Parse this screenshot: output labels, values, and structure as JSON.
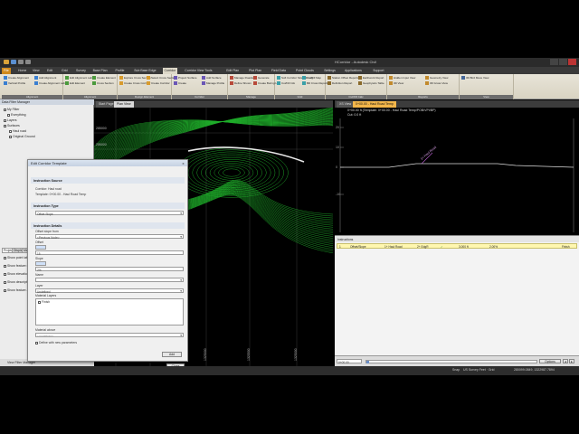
{
  "titlebar": {
    "title": "HCorridor - Autodesk Civil"
  },
  "tabs": [
    {
      "label": "File",
      "file": true
    },
    {
      "label": "Home"
    },
    {
      "label": "View"
    },
    {
      "label": "Edit"
    },
    {
      "label": "Grid"
    },
    {
      "label": "Survey"
    },
    {
      "label": "Base Plan"
    },
    {
      "label": "Profile"
    },
    {
      "label": "Sub Base Edge"
    },
    {
      "label": "Corridor",
      "active": true
    },
    {
      "label": "Corridor View Tools"
    },
    {
      "label": "Edit Plan"
    },
    {
      "label": "Plot Plan"
    },
    {
      "label": "Field Data"
    },
    {
      "label": "Point Clouds"
    },
    {
      "label": "Settings"
    },
    {
      "label": "Applications"
    },
    {
      "label": "Support"
    }
  ],
  "ribbon": {
    "groups": [
      {
        "label": "Alignment"
      },
      {
        "label": "Alignment"
      },
      {
        "label": "Design Element"
      },
      {
        "label": "Corridor"
      },
      {
        "label": "Manage"
      },
      {
        "label": "Grid"
      },
      {
        "label": "Cut/Fill Calc"
      },
      {
        "label": "Reports"
      },
      {
        "label": "View"
      }
    ],
    "buttons": [
      {
        "label": "Create Alignment"
      },
      {
        "label": "Add Alignment"
      },
      {
        "label": "Vertical Profile"
      },
      {
        "label": "Create Alignment Labels"
      },
      {
        "label": "Edit Alignment Labels"
      },
      {
        "label": "Create Element"
      },
      {
        "label": "Edit Element"
      },
      {
        "label": "Cross Section"
      },
      {
        "label": "Explore Cross Section"
      },
      {
        "label": "Select Cross Section"
      },
      {
        "label": "Create Cross Corridor"
      },
      {
        "label": "Create Corridor"
      },
      {
        "label": "Project Surface"
      },
      {
        "label": "Add Surface"
      },
      {
        "label": "Create"
      },
      {
        "label": "Manage Profile"
      },
      {
        "label": "Manage Roadway"
      },
      {
        "label": "Generate"
      },
      {
        "label": "Define Shown"
      },
      {
        "label": "Create Boring Log"
      },
      {
        "label": "Soft Corridor Strength Log"
      },
      {
        "label": "Cut/Fill Map"
      },
      {
        "label": "Cut/Fill Info"
      },
      {
        "label": "Bill Cross Reporting"
      },
      {
        "label": "Station Offset Reports"
      },
      {
        "label": "Earthwork Report"
      },
      {
        "label": "Definition Report"
      },
      {
        "label": "Geophysics Table"
      },
      {
        "label": "Hidden Input View"
      },
      {
        "label": "Geometry View"
      },
      {
        "label": "3D View"
      },
      {
        "label": "3D Gross View"
      },
      {
        "label": "3D Bird Move View"
      }
    ]
  },
  "left_panel": {
    "header": "Data Filter Manager",
    "rows": [
      {
        "label": "My Filter",
        "checked": true
      },
      {
        "label": "Everything",
        "checked": true
      },
      {
        "label": "Layers",
        "checked": true
      },
      {
        "label": "Surfaces",
        "checked": true
      },
      {
        "label": "Haul road",
        "checked": true
      },
      {
        "label": "Original Ground",
        "checked": true
      }
    ],
    "side_tabs": [
      "Project",
      "Display",
      "Map"
    ],
    "options": [
      {
        "label": "Show point labels"
      },
      {
        "label": "Show feature codes"
      },
      {
        "label": "Show elevation"
      },
      {
        "label": "Show description"
      },
      {
        "label": "Show feature attributes"
      }
    ],
    "bottom": "View Filter Manager"
  },
  "viewport": {
    "tabs": [
      {
        "label": "Start Page"
      },
      {
        "label": "Plan View",
        "active": true
      }
    ],
    "labels": [
      "285000",
      "286000",
      "1324000",
      "1324500",
      "1325000",
      "1325500",
      "1325000"
    ]
  },
  "dialog": {
    "title": "Edit Corridor Template",
    "close": "x",
    "section_instruction": "Instruction Source",
    "corridor_label": "Corridor",
    "corridor_value": "Haul road",
    "template_label": "Template",
    "template_value": "0+00.00 - Haul Road Temp",
    "section_type": "Instruction Type",
    "instruction_type_value": "Offset Slope",
    "section_details": "Instruction Details",
    "offset_from_label": "Offset slope from",
    "offset_from_value": "<Previous Node>",
    "offset_label": "Offset",
    "offset_value": "15",
    "slope_label": "Slope",
    "slope_value": "2%",
    "name_label": "Name",
    "name_value": "",
    "layer_label": "Layer",
    "layer_value": "Undefined",
    "material_layers_label": "Material Layers",
    "material_layer_item": "Finish",
    "material_above_label": "Material above",
    "material_above_value": "<Undefined>",
    "define_label": "Define with new parameters",
    "add_button": "Add",
    "close_button": "Close"
  },
  "profile": {
    "tab": "0+00.00 - Haul Road Temp",
    "tab_label": "XS View",
    "header_line1": "0+00.00 ft  (Template: 0+00.00 - Haul Road Temp/POB/VPI/BP)",
    "header_line2": "Cut: 0.0 ft",
    "axis_labels": [
      "20",
      "10",
      "0",
      "-10"
    ],
    "point_label": "1+ Haul Road"
  },
  "instr_grid": {
    "header": "Instructions",
    "row": {
      "index": "1",
      "type": "Offset/Slope",
      "from": "1+ Haul Road",
      "to": "2+ EdgR",
      "check": "✓",
      "offset": "3.000 ft",
      "slope": "2.00%",
      "finish": "Finish"
    }
  },
  "timeline": {
    "start": "0+00.00",
    "options_label": "Options"
  },
  "statusbar": {
    "snap": "Snap",
    "coords_system": "US Survey Feet · Grid",
    "coords": "280099.0849, 1322987.7894"
  }
}
